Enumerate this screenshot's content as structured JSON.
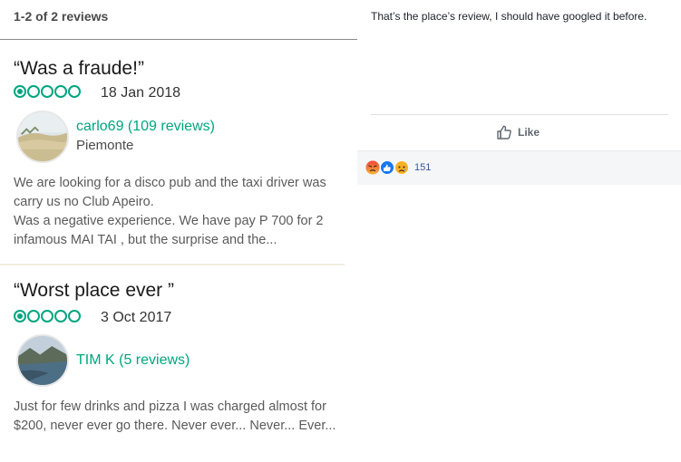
{
  "left_panel": {
    "review_count": "1-2 of 2 reviews",
    "reviews": [
      {
        "title": "“Was a fraude!”",
        "rating_bubbles": 1,
        "rating_max": 5,
        "date": "18 Jan 2018",
        "user": "carlo69 (109 reviews)",
        "location": "Piemonte",
        "avatar_icon": "beach-photo-avatar",
        "body_lines": [
          "We are looking for a disco pub and the taxi driver was carry us no Club Apeiro.",
          "Was a negative experience. We have pay P 700 for 2 infamous MAI TAI , but the surprise and the..."
        ]
      },
      {
        "title": "“Worst place ever ”",
        "rating_bubbles": 1,
        "rating_max": 5,
        "date": "3 Oct 2017",
        "user": "TIM K (5 reviews)",
        "location": "",
        "avatar_icon": "lake-photo-avatar",
        "body_lines": [
          "Just for few drinks and pizza I was charged almost for $200, never ever go there. Never ever... Never... Ever..."
        ]
      }
    ],
    "colors": {
      "accent": "#00a680",
      "text": "#333333"
    }
  },
  "right_panel": {
    "comment_text": "That’s the place’s review, I should have googled it before.",
    "like_label": "Like",
    "like_icon": "thumbs-up-outline-icon",
    "reaction_icons": [
      "angry-reaction-icon",
      "like-reaction-icon",
      "sad-reaction-icon"
    ],
    "reaction_count": "151",
    "colors": {
      "link": "#365899",
      "muted": "#606770"
    }
  }
}
